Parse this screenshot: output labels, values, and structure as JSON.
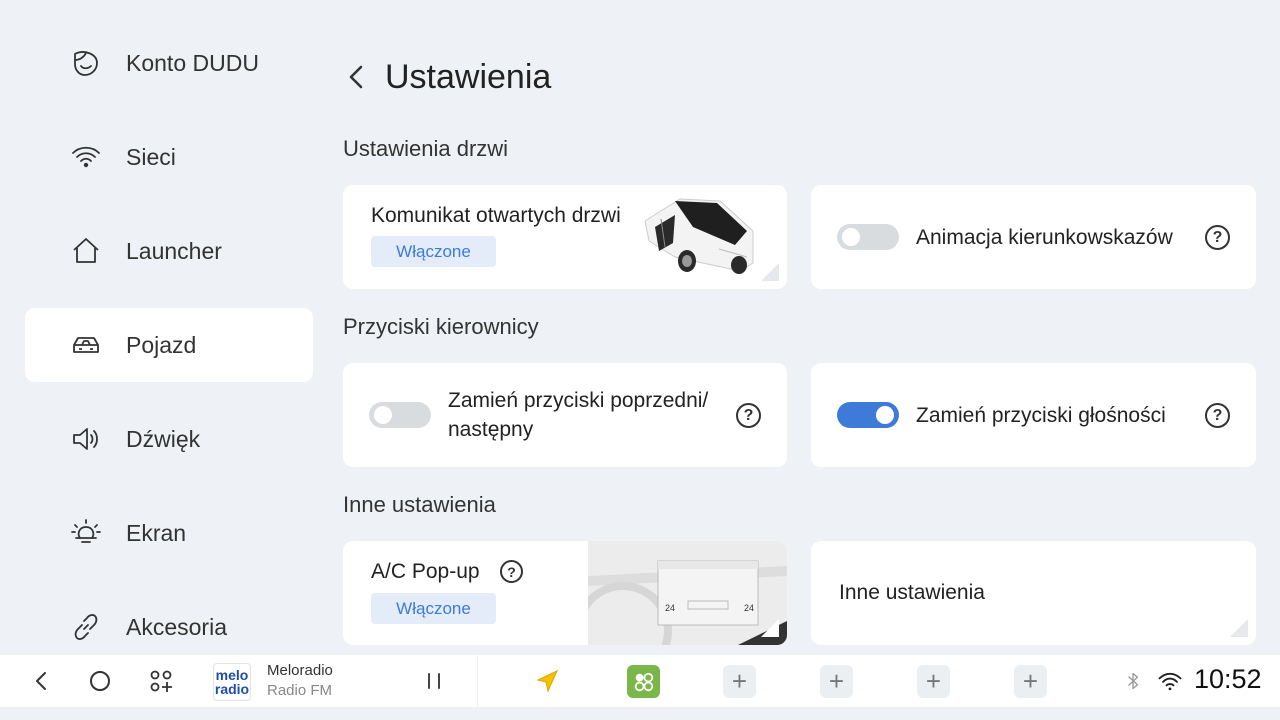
{
  "sidebar": {
    "items": [
      {
        "label": "Konto DUDU",
        "icon": "account-face-icon"
      },
      {
        "label": "Sieci",
        "icon": "wifi-icon"
      },
      {
        "label": "Launcher",
        "icon": "home-icon"
      },
      {
        "label": "Pojazd",
        "icon": "car-icon",
        "active": true
      },
      {
        "label": "Dźwięk",
        "icon": "speaker-icon"
      },
      {
        "label": "Ekran",
        "icon": "brightness-icon"
      },
      {
        "label": "Akcesoria",
        "icon": "link-icon"
      }
    ]
  },
  "header": {
    "title": "Ustawienia"
  },
  "sections": {
    "doors": {
      "title": "Ustawienia drzwi",
      "door_message": {
        "label": "Komunikat otwartych drzwi",
        "status": "Włączone"
      },
      "turn_signal": {
        "label": "Animacja kierunkowskazów",
        "enabled": false
      }
    },
    "steering": {
      "title": "Przyciski kierownicy",
      "swap_prev_next": {
        "label_line1": "Zamień przyciski poprzedni/",
        "label_line2": "następny",
        "enabled": false
      },
      "swap_volume": {
        "label": "Zamień przyciski głośności",
        "enabled": true
      }
    },
    "other": {
      "title": "Inne ustawienia",
      "ac_popup": {
        "label": "A/C Pop-up",
        "status": "Włączone",
        "temp_left": "24",
        "temp_right": "24"
      },
      "other_settings": {
        "label": "Inne ustawienia"
      }
    }
  },
  "help_glyph": "?",
  "bottombar": {
    "media": {
      "logo_line1": "melo",
      "logo_line2": "radio",
      "title": "Meloradio",
      "subtitle": "Radio FM"
    },
    "plus": "+",
    "time": "10:52"
  },
  "colors": {
    "accent": "#3e7bd8",
    "badge_bg": "#e3ecf8",
    "background": "#eef1f5",
    "app_green": "#7ab648"
  }
}
